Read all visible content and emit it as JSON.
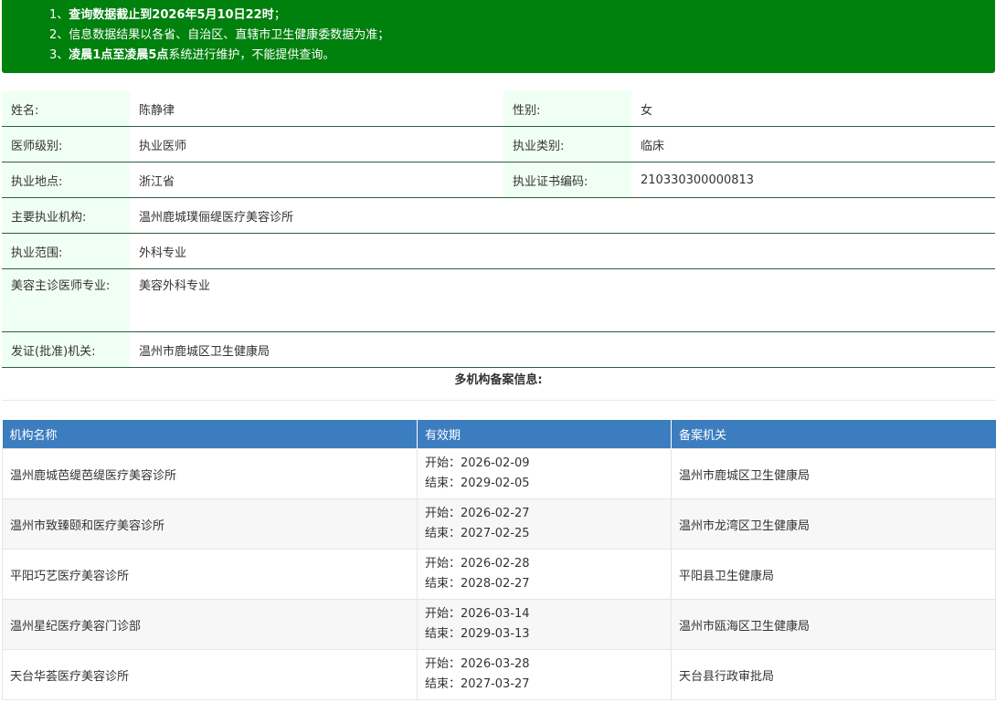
{
  "notice": {
    "line1": {
      "prefix": "1、",
      "bold": "查询数据截止到2026年5月10日22时",
      "suffix": "；"
    },
    "line2": {
      "text": "2、信息数据结果以各省、自治区、直辖市卫生健康委数据为准；"
    },
    "line3": {
      "prefix": "3、",
      "bold": "凌晨1点至凌晨5点",
      "suffix": "系统进行维护，不能提供查询。"
    }
  },
  "doctor": {
    "name_label": "姓名:",
    "name": "陈静律",
    "gender_label": "性别:",
    "gender": "女",
    "level_label": "医师级别:",
    "level": "执业医师",
    "category_label": "执业类别:",
    "category": "临床",
    "location_label": "执业地点:",
    "location": "浙江省",
    "cert_label": "执业证书编码:",
    "cert": "210330300000813",
    "institution_label": "主要执业机构:",
    "institution": "温州鹿城璞俪缇医疗美容诊所",
    "scope_label": "执业范围:",
    "scope": "外科专业",
    "cosmetic_label": "美容主诊医师专业:",
    "cosmetic": "美容外科专业",
    "authority_label": "发证(批准)机关:",
    "authority": "温州市鹿城区卫生健康局"
  },
  "multi_title": "多机构备案信息:",
  "org_table": {
    "headers": [
      "机构名称",
      "有效期",
      "备案机关"
    ],
    "start_label": "开始：",
    "end_label": "结束：",
    "rows": [
      {
        "name": "温州鹿城芭缇芭缇医疗美容诊所",
        "start": "2026-02-09",
        "end": "2029-02-05",
        "authority": "温州市鹿城区卫生健康局"
      },
      {
        "name": "温州市致臻颐和医疗美容诊所",
        "start": "2026-02-27",
        "end": "2027-02-25",
        "authority": "温州市龙湾区卫生健康局"
      },
      {
        "name": "平阳巧艺医疗美容诊所",
        "start": "2026-02-28",
        "end": "2028-02-27",
        "authority": "平阳县卫生健康局"
      },
      {
        "name": "温州星纪医疗美容门诊部",
        "start": "2026-03-14",
        "end": "2029-03-13",
        "authority": "温州市瓯海区卫生健康局"
      },
      {
        "name": "天台华荟医疗美容诊所",
        "start": "2026-03-28",
        "end": "2027-03-27",
        "authority": "天台县行政审批局"
      }
    ]
  }
}
